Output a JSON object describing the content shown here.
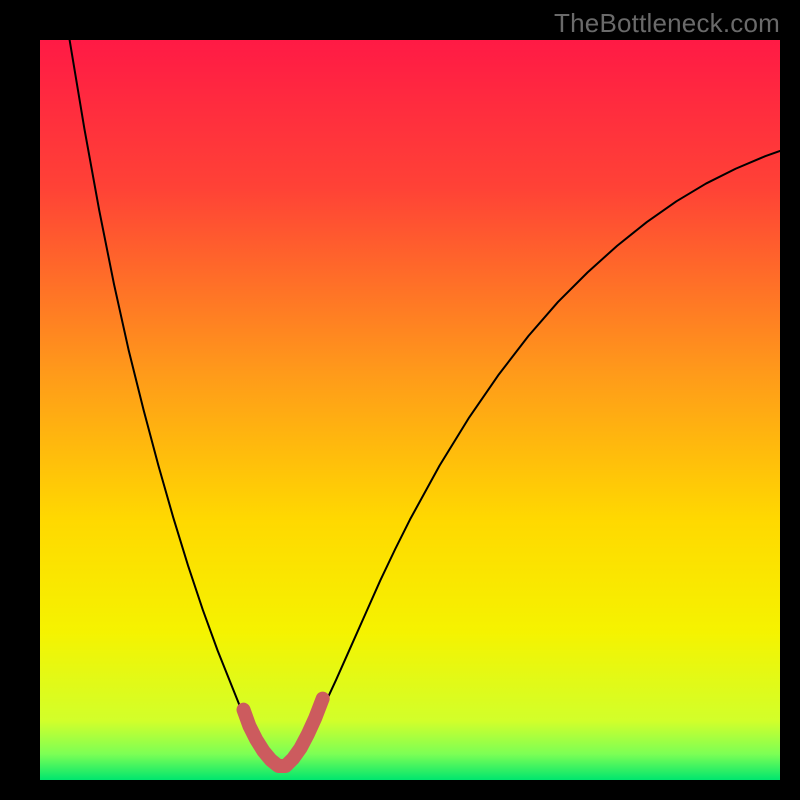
{
  "watermark": "TheBottleneck.com",
  "colors": {
    "black": "#000000",
    "curve": "#000000",
    "marker": "#cc5b5e",
    "gradient_stops": [
      {
        "offset": 0.0,
        "color": "#ff1a45"
      },
      {
        "offset": 0.2,
        "color": "#ff4236"
      },
      {
        "offset": 0.45,
        "color": "#ff9a1a"
      },
      {
        "offset": 0.65,
        "color": "#ffd900"
      },
      {
        "offset": 0.8,
        "color": "#f5f300"
      },
      {
        "offset": 0.92,
        "color": "#d2ff2a"
      },
      {
        "offset": 0.965,
        "color": "#7cff55"
      },
      {
        "offset": 1.0,
        "color": "#00e66e"
      }
    ]
  },
  "chart_data": {
    "type": "line",
    "title": "",
    "xlabel": "",
    "ylabel": "",
    "xlim": [
      0,
      100
    ],
    "ylim": [
      0,
      100
    ],
    "grid": false,
    "series": [
      {
        "name": "bottleneck-curve-left",
        "x": [
          4,
          6,
          8,
          10,
          12,
          14,
          16,
          18,
          20,
          22,
          24,
          26,
          27,
          28,
          29,
          30,
          31,
          32
        ],
        "values": [
          100,
          88,
          77,
          67,
          58,
          50,
          42.5,
          35.5,
          29,
          23,
          17.5,
          12.5,
          10,
          8,
          6.2,
          4.5,
          3,
          1.6
        ]
      },
      {
        "name": "bottleneck-curve-right",
        "x": [
          34,
          35,
          36,
          37,
          38,
          40,
          42,
          44,
          46,
          48,
          50,
          54,
          58,
          62,
          66,
          70,
          74,
          78,
          82,
          86,
          90,
          94,
          98,
          100
        ],
        "values": [
          1.6,
          3.2,
          5,
          7,
          9.2,
          13.5,
          18,
          22.5,
          27,
          31.2,
          35.2,
          42.5,
          49,
          54.8,
          60,
          64.6,
          68.6,
          72.2,
          75.4,
          78.2,
          80.6,
          82.6,
          84.3,
          85
        ]
      },
      {
        "name": "marker-u",
        "x": [
          27.5,
          28.3,
          29.2,
          30.2,
          31.2,
          32.2,
          33.2,
          34.2,
          35.2,
          36.2,
          37.2,
          38.2
        ],
        "values": [
          9.5,
          7.3,
          5.5,
          3.9,
          2.7,
          1.9,
          1.9,
          2.9,
          4.3,
          6.2,
          8.4,
          11
        ]
      }
    ],
    "legend": false
  }
}
